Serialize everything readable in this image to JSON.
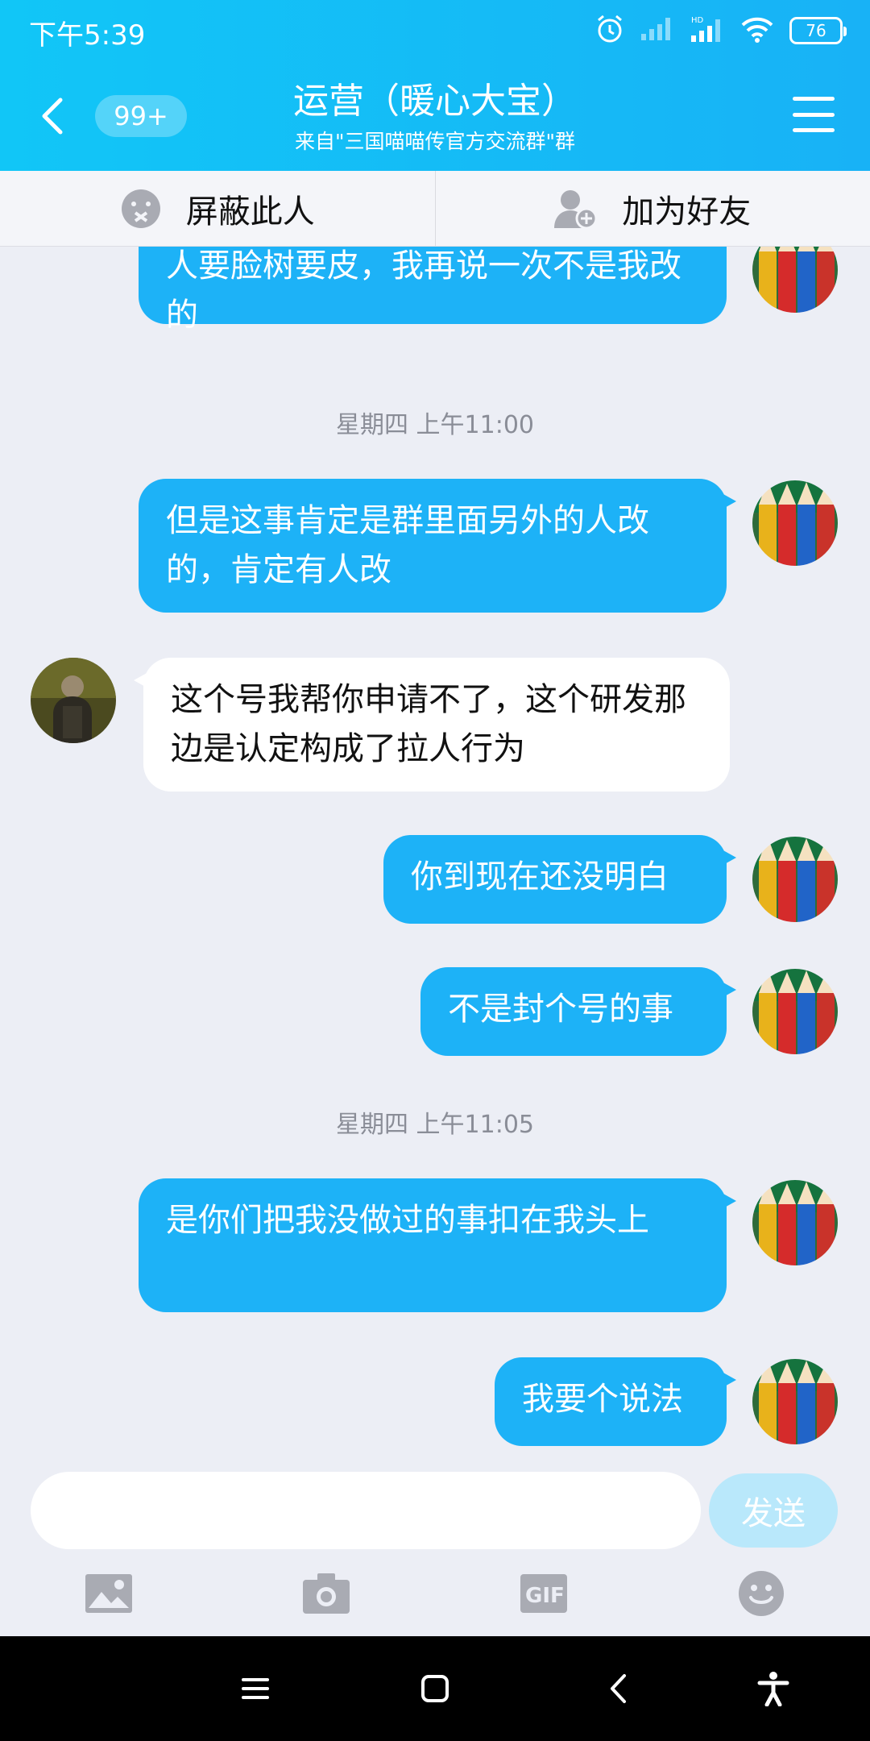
{
  "status_bar": {
    "time": "下午5:39",
    "battery": "76",
    "icons": [
      "alarm-icon",
      "signal-icon",
      "hd-signal-icon",
      "wifi-icon",
      "battery-icon"
    ]
  },
  "nav": {
    "back_icon": "chevron-left-icon",
    "unread": "99+",
    "title": "运营（暖心大宝）",
    "subtitle": "来自\"三国喵喵传官方交流群\"群",
    "menu_icon": "hamburger-icon"
  },
  "actions": {
    "block_label": "屏蔽此人",
    "add_friend_label": "加为好友"
  },
  "chat": {
    "msg1": "人要脸树要皮，我再说一次不是我改的",
    "time1": "星期四 上午11:00",
    "msg2": "但是这事肯定是群里面另外的人改的，肯定有人改",
    "msg3": "这个号我帮你申请不了，这个研发那边是认定构成了拉人行为",
    "msg4": "你到现在还没明白",
    "msg5": "不是封个号的事",
    "time2": "星期四 上午11:05",
    "msg6": "是你们把我没做过的事扣在我头上",
    "msg7": "我要个说法"
  },
  "input": {
    "placeholder": "",
    "send_label": "发送"
  },
  "toolbar": [
    "image-icon",
    "camera-icon",
    "gif-icon",
    "emoji-icon"
  ],
  "colors": {
    "header": "#18b2f6",
    "sent_bubble": "#1db2f7",
    "recv_bubble": "#ffffff",
    "background": "#eceef5",
    "send_button": "#b9e8fb"
  }
}
